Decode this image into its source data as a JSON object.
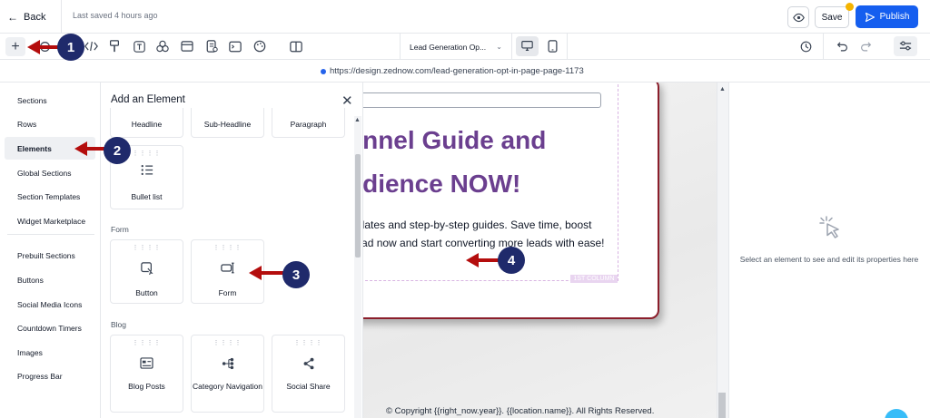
{
  "topbar": {
    "back_label": "Back",
    "last_saved": "Last saved 4 hours ago",
    "save_label": "Save",
    "publish_label": "Publish"
  },
  "toolbar": {
    "page_select": "Lead Generation Op...",
    "icons": [
      "plus-icon",
      "layers-icon",
      "code-icon",
      "paint-icon",
      "text-icon",
      "shapes-icon",
      "section-icon",
      "form-doc-icon",
      "terminal-icon",
      "palette-icon",
      "columns-icon",
      "desktop-icon",
      "mobile-icon",
      "history-icon",
      "undo-icon",
      "redo-icon",
      "settings-sliders-icon"
    ]
  },
  "url": {
    "text": "https://design.zednow.com/lead-generation-opt-in-page-page-1173"
  },
  "leftnav": {
    "items": [
      {
        "label": "Sections"
      },
      {
        "label": "Rows"
      },
      {
        "label": "Elements"
      },
      {
        "label": "Global Sections"
      },
      {
        "label": "Section Templates"
      },
      {
        "label": "Widget Marketplace"
      },
      {
        "label": "Prebuilt Sections"
      },
      {
        "label": "Buttons"
      },
      {
        "label": "Social Media Icons"
      },
      {
        "label": "Countdown Timers"
      },
      {
        "label": "Images"
      },
      {
        "label": "Progress Bar"
      }
    ],
    "active": "Elements"
  },
  "panel": {
    "title": "Add an Element",
    "top_cards": [
      {
        "label": "Headline"
      },
      {
        "label": "Sub-Headline"
      },
      {
        "label": "Paragraph"
      }
    ],
    "bullet_card": {
      "label": "Bullet list"
    },
    "form_section": "Form",
    "form_cards": [
      {
        "label": "Button"
      },
      {
        "label": "Form"
      }
    ],
    "blog_section": "Blog",
    "blog_cards": [
      {
        "label": "Blog Posts"
      },
      {
        "label": "Category Navigation"
      },
      {
        "label": "Social Share"
      }
    ]
  },
  "canvas": {
    "headline_line1": "unnel Guide and",
    "headline_line2": "udience NOW!",
    "subtext_line1": "mplates and step-by-step guides. Save time, boost",
    "subtext_line2": "nload now and start converting more leads with ease!",
    "column_tag": "1ST COLUMN",
    "footer": "© Copyright {{right_now.year}}. {{location.name}}. All Rights Reserved."
  },
  "properties": {
    "empty_text": "Select an element to see and edit its properties here"
  },
  "annotations": {
    "badges": [
      "1",
      "2",
      "3",
      "4"
    ],
    "arrow_color": "#b40d0d",
    "badge_color": "#1f2a6b"
  },
  "colors": {
    "publish": "#155eef",
    "headline": "#6b3f8f",
    "card_border": "#8b1e2b"
  }
}
